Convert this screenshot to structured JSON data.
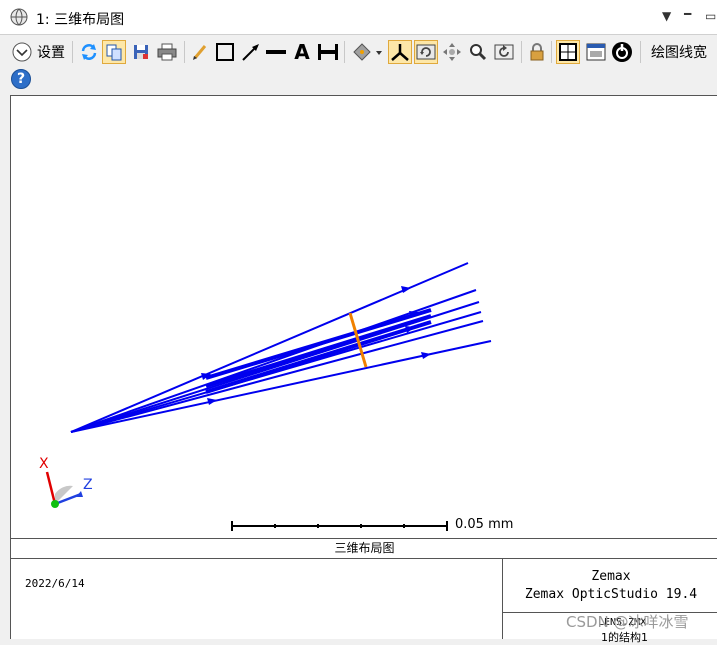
{
  "window": {
    "title": "1: 三维布局图",
    "controls": [
      "dropdown-arrow",
      "pin",
      "restore"
    ]
  },
  "toolbar": {
    "settings_label": "设置",
    "line_width_label": "绘图线宽",
    "help_label": "?",
    "icons": [
      "settings-chevron",
      "refresh",
      "copy",
      "save",
      "print",
      "pencil",
      "rectangle",
      "arrow-line",
      "line",
      "text-A",
      "dimension",
      "rotate-view",
      "axes",
      "rotate-tool",
      "pan",
      "zoom",
      "reset-view",
      "lock",
      "fit",
      "window-layout",
      "power-target"
    ]
  },
  "layout_plot": {
    "scale_bar_label": "0.05 mm",
    "axis_labels": {
      "x": "X",
      "z": "Z"
    },
    "colors": {
      "rays": "#0000ee",
      "surface": "#f08000",
      "axis_x": "#e00000",
      "axis_z": "#2040e0",
      "axis_y": "#10c010"
    }
  },
  "footer": {
    "caption": "三维布局图",
    "date": "2022/6/14",
    "company": "Zemax",
    "product": "Zemax OpticStudio 19.4",
    "lens_file": "LENS.ZMX",
    "configuration": "1的结构1"
  },
  "watermark": "CSDN @冰咩冰雪"
}
